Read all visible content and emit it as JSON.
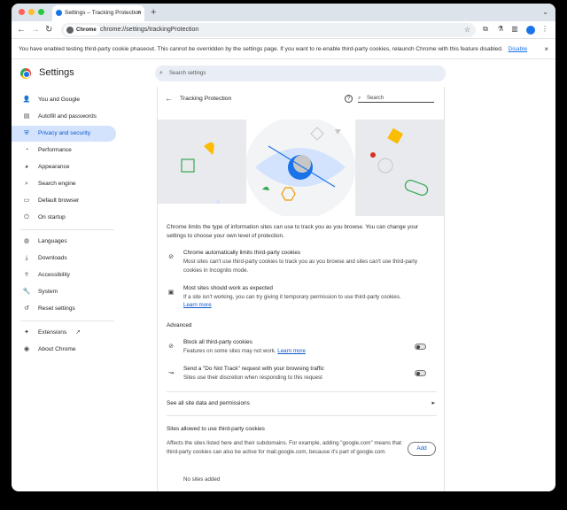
{
  "browser": {
    "tab_title": "Settings – Tracking Protection",
    "new_tab": "+",
    "tab_close": "×",
    "omnibox_chip": "Chrome",
    "url": "chrome://settings/trackingProtection"
  },
  "infobar": {
    "message": "You have enabled testing third-party cookie phaseout. This cannot be overridden by the settings page. If you want to re-enable third-party cookies, relaunch Chrome with this feature disabled.",
    "link": "Disable",
    "close": "×"
  },
  "header": {
    "title": "Settings",
    "search_placeholder": "Search settings"
  },
  "sidebar": {
    "items": [
      {
        "label": "You and Google",
        "icon": "person-icon"
      },
      {
        "label": "Autofill and passwords",
        "icon": "clipboard-icon"
      },
      {
        "label": "Privacy and security",
        "icon": "shield-icon"
      },
      {
        "label": "Performance",
        "icon": "speedometer-icon"
      },
      {
        "label": "Appearance",
        "icon": "palette-icon"
      },
      {
        "label": "Search engine",
        "icon": "search-icon"
      },
      {
        "label": "Default browser",
        "icon": "browser-icon"
      },
      {
        "label": "On startup",
        "icon": "power-icon"
      },
      {
        "label": "Languages",
        "icon": "globe-icon"
      },
      {
        "label": "Downloads",
        "icon": "download-icon"
      },
      {
        "label": "Accessibility",
        "icon": "accessibility-icon"
      },
      {
        "label": "System",
        "icon": "wrench-icon"
      },
      {
        "label": "Reset settings",
        "icon": "history-icon"
      },
      {
        "label": "Extensions",
        "icon": "puzzle-icon"
      },
      {
        "label": "About Chrome",
        "icon": "chrome-icon"
      }
    ]
  },
  "page": {
    "title": "Tracking Protection",
    "search_placeholder": "Search",
    "description": "Chrome limits the type of information sites can use to track you as you browse. You can change your settings to choose your own level of protection.",
    "feature1_title": "Chrome automatically limits third-party cookies",
    "feature1_desc": "Most sites can't use third-party cookies to track you as you browse and sites can't use third-party cookies in Incognito mode.",
    "feature2_title": "Most sites should work as expected",
    "feature2_desc": "If a site isn't working, you can try giving it temporary permission to use third-party cookies.",
    "feature2_link": "Learn more",
    "advanced": "Advanced",
    "block_title": "Block all third-party cookies",
    "block_desc": "Features on some sites may not work.",
    "block_link": "Learn more",
    "block_enabled": false,
    "dnt_title": "Send a \"Do Not Track\" request with your browsing traffic",
    "dnt_desc": "Sites use their discretion when responding to this request",
    "dnt_enabled": false,
    "site_data": "See all site data and permissions",
    "allowed_title": "Sites allowed to use third-party cookies",
    "allowed_desc": "Affects the sites listed here and their subdomains. For example, adding \"google.com\" means that third-party cookies can also be active for mail.google.com, because it's part of google.com.",
    "add_button": "Add",
    "no_sites": "No sites added"
  },
  "colors": {
    "accent": "#0b57d0",
    "active_bg": "#d3e3fd",
    "tabstrip": "#dde3ea"
  }
}
